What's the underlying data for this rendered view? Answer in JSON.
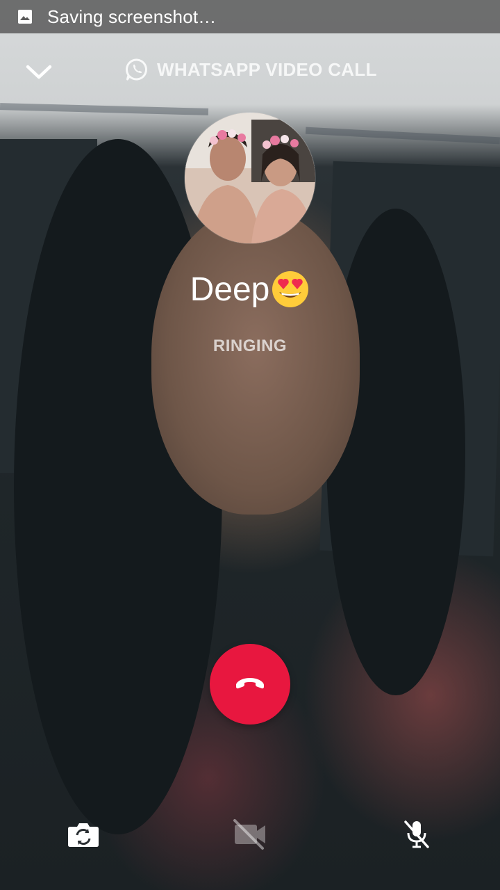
{
  "status_bar": {
    "notification_icon": "image-icon",
    "text": "Saving screenshot…"
  },
  "header": {
    "collapse_icon": "chevron-down-icon",
    "app_icon": "whatsapp-icon",
    "call_type_label": "WHATSAPP VIDEO CALL"
  },
  "contact": {
    "avatar_icon": "avatar",
    "name": "Deep",
    "name_emoji": "heart-eyes-emoji",
    "call_status": "RINGING"
  },
  "actions": {
    "end_call_icon": "phone-hangup-icon",
    "end_call_color": "#e8173f",
    "switch_camera_icon": "camera-switch-icon",
    "video_off_icon": "video-off-icon",
    "mute_icon": "mic-off-icon"
  }
}
